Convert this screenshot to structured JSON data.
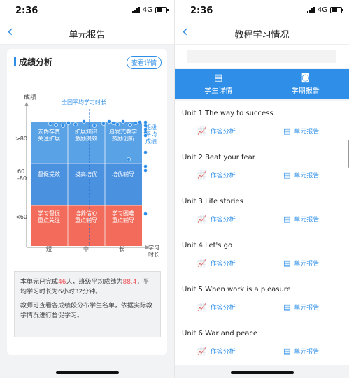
{
  "left": {
    "status": {
      "time": "2:36",
      "network": "4G"
    },
    "nav": {
      "back": "‹",
      "title": "单元报告"
    },
    "section": {
      "title": "成绩分析",
      "detail_btn": "查看详情"
    },
    "chart_data": {
      "type": "scatter",
      "ylabel": "成绩",
      "xlabel": "学习\n时长",
      "x_categories": [
        "短",
        "中",
        "长"
      ],
      "y_categories": [
        ">80",
        "60\n-80",
        "<60"
      ],
      "avg_line_label": "全国平均学习时长",
      "class_avg_label": "班级\n平均\n成绩",
      "cells": [
        [
          "去伪存真\n关注扩展",
          "扩展知识\n激励提效",
          "启发式教学\n鼓励创新"
        ],
        [
          "督促提效",
          "拔高培优",
          "培优辅导"
        ],
        [
          "学习督促\n重点关注",
          "培养信心\n重点辅导",
          "学习困难\n重点辅导"
        ]
      ],
      "colors": {
        "top": "#5aa2e6",
        "mid": "#4a91e0",
        "low": "#f26b5b",
        "accent": "#2f8fe8"
      }
    },
    "note": {
      "p1_a": "本单元已完成",
      "p1_count": "46",
      "p1_b": "人，班级平均成绩为",
      "p1_score": "88.4",
      "p1_c": "，平均学习时长为6小时32分钟。",
      "p2": "教师可查看各成绩段分布学生名单，依据实际教学情况进行督促学习。"
    }
  },
  "right": {
    "status": {
      "time": "2:36",
      "network": "4G"
    },
    "nav": {
      "back": "‹",
      "title": "教程学习情况"
    },
    "tabs": [
      {
        "label": "学生详情",
        "icon": "document-icon"
      },
      {
        "label": "学期报告",
        "icon": "report-icon"
      }
    ],
    "units": [
      {
        "title": "Unit 1 The way to success",
        "a1": "作答分析",
        "a2": "单元报告"
      },
      {
        "title": "Unit 2 Beat your fear",
        "a1": "作答分析",
        "a2": "单元报告"
      },
      {
        "title": "Unit 3 Life stories",
        "a1": "作答分析",
        "a2": "单元报告"
      },
      {
        "title": "Unit 4 Let's go",
        "a1": "作答分析",
        "a2": "单元报告"
      },
      {
        "title": "Unit 5 When work is a pleasure",
        "a1": "作答分析",
        "a2": "单元报告"
      },
      {
        "title": "Unit 6 War and peace",
        "a1": "作答分析",
        "a2": "单元报告"
      }
    ]
  }
}
